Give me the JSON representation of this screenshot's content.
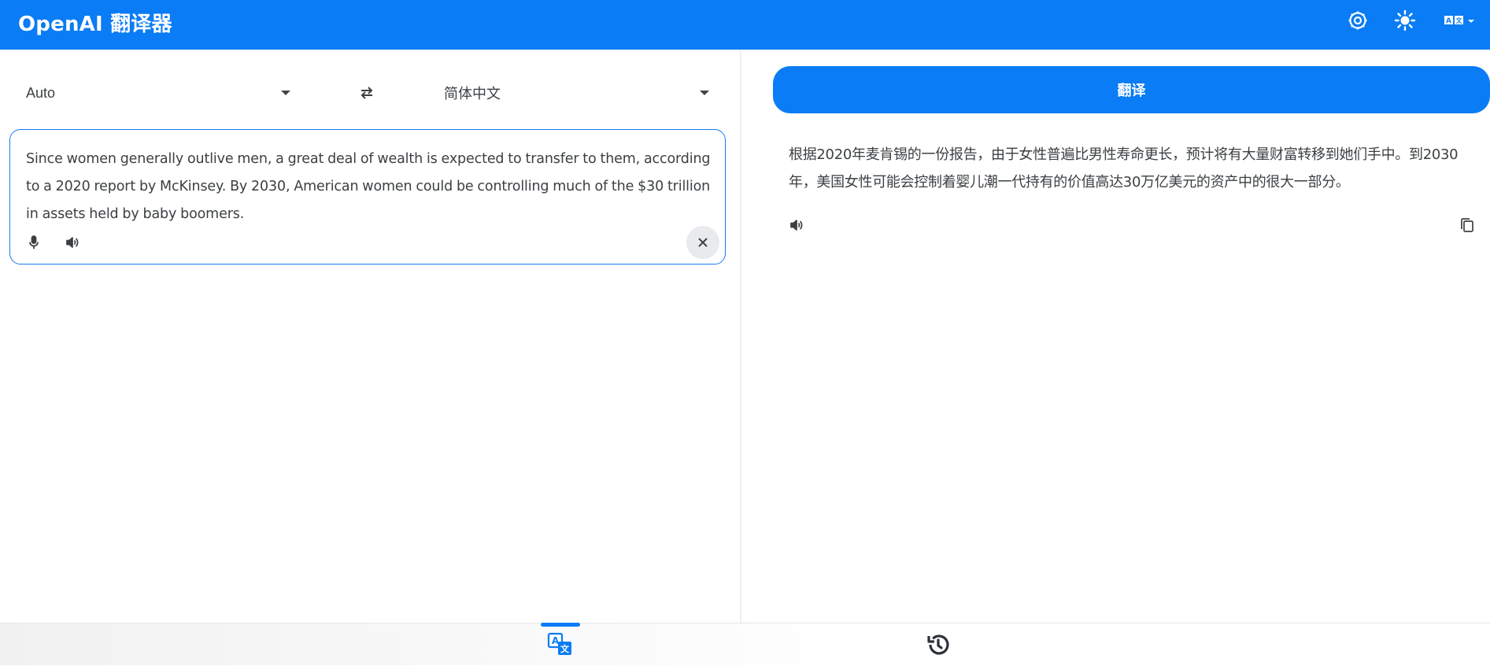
{
  "header": {
    "title": "OpenAI 翻译器",
    "icons": [
      "openai-settings-icon",
      "theme-sun-icon",
      "language-translate-icon"
    ]
  },
  "source": {
    "language": "Auto",
    "text": "Since women generally outlive men, a great deal of wealth is expected to transfer to them, according to a 2020 report by McKinsey. By 2030, American women could be controlling much of the $30 trillion in assets held by baby boomers."
  },
  "target": {
    "language": "简体中文"
  },
  "translate_button_label": "翻译",
  "result": {
    "text": "根据2020年麦肯锡的一份报告，由于女性普遍比男性寿命更长，预计将有大量财富转移到她们手中。到2030年，美国女性可能会控制着婴儿潮一代持有的价值高达30万亿美元的资产中的很大一部分。"
  },
  "bottom_nav": {
    "tabs": [
      "translate-tab",
      "history-tab"
    ],
    "active": "translate-tab"
  },
  "colors": {
    "accent": "#0a7cf5",
    "text": "#3c4043",
    "clear_bg": "#e8eaed"
  }
}
